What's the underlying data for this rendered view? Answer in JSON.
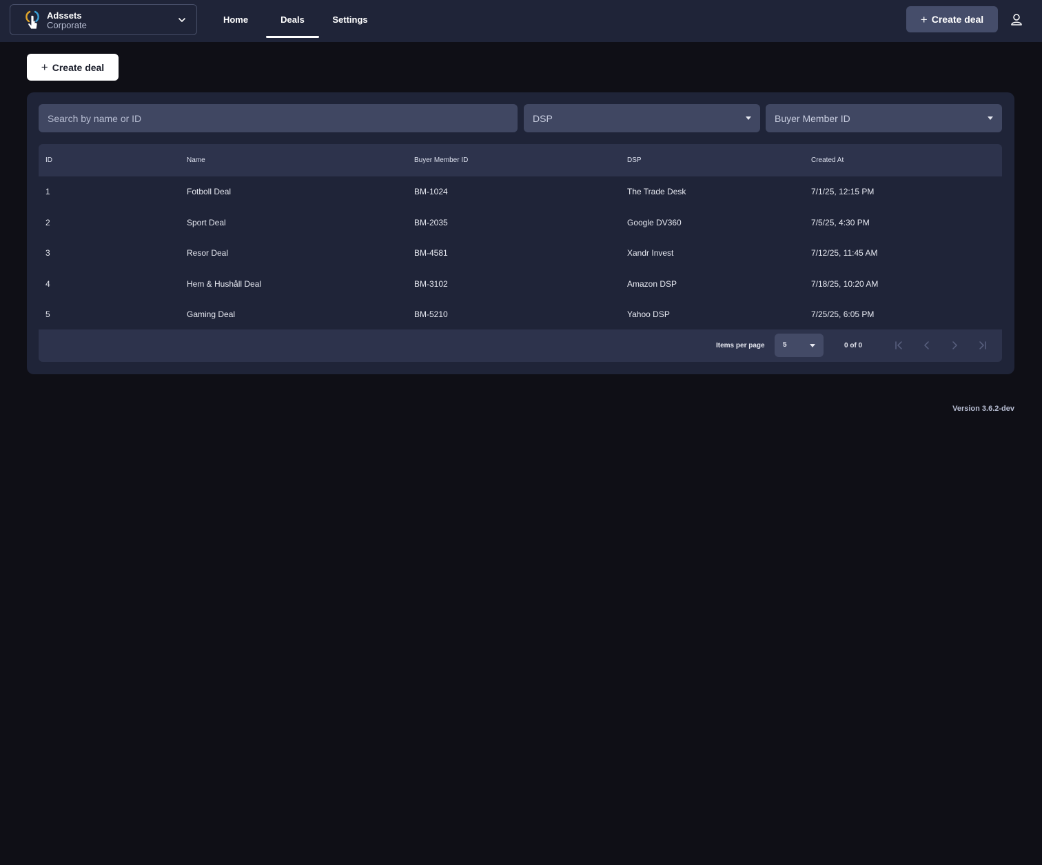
{
  "org": {
    "name": "Adssets",
    "subtitle": "Corporate"
  },
  "nav": {
    "home": "Home",
    "deals": "Deals",
    "settings": "Settings",
    "active": "Deals"
  },
  "header": {
    "create_label": "Create deal"
  },
  "page": {
    "create_label": "Create deal"
  },
  "filters": {
    "search_placeholder": "Search by name or ID",
    "dsp_placeholder": "DSP",
    "buyer_placeholder": "Buyer Member ID"
  },
  "table": {
    "columns": [
      "ID",
      "Name",
      "Buyer Member ID",
      "DSP",
      "Created At"
    ],
    "rows": [
      [
        "1",
        "Fotboll Deal",
        "BM-1024",
        "The Trade Desk",
        "7/1/25, 12:15 PM"
      ],
      [
        "2",
        "Sport Deal",
        "BM-2035",
        "Google DV360",
        "7/5/25, 4:30 PM"
      ],
      [
        "3",
        "Resor Deal",
        "BM-4581",
        "Xandr Invest",
        "7/12/25, 11:45 AM"
      ],
      [
        "4",
        "Hem & Hushåll Deal",
        "BM-3102",
        "Amazon DSP",
        "7/18/25, 10:20 AM"
      ],
      [
        "5",
        "Gaming Deal",
        "BM-5210",
        "Yahoo DSP",
        "7/25/25, 6:05 PM"
      ]
    ]
  },
  "pagination": {
    "items_per_page_label": "Items per page",
    "items_per_page": "5",
    "range": "0 of 0"
  },
  "footer": {
    "version": "Version 3.6.2-dev"
  },
  "colors": {
    "topbar": "#1f2438",
    "card": "#1f2438",
    "page_bg": "#0f0f16",
    "accent": "#454d6a"
  }
}
